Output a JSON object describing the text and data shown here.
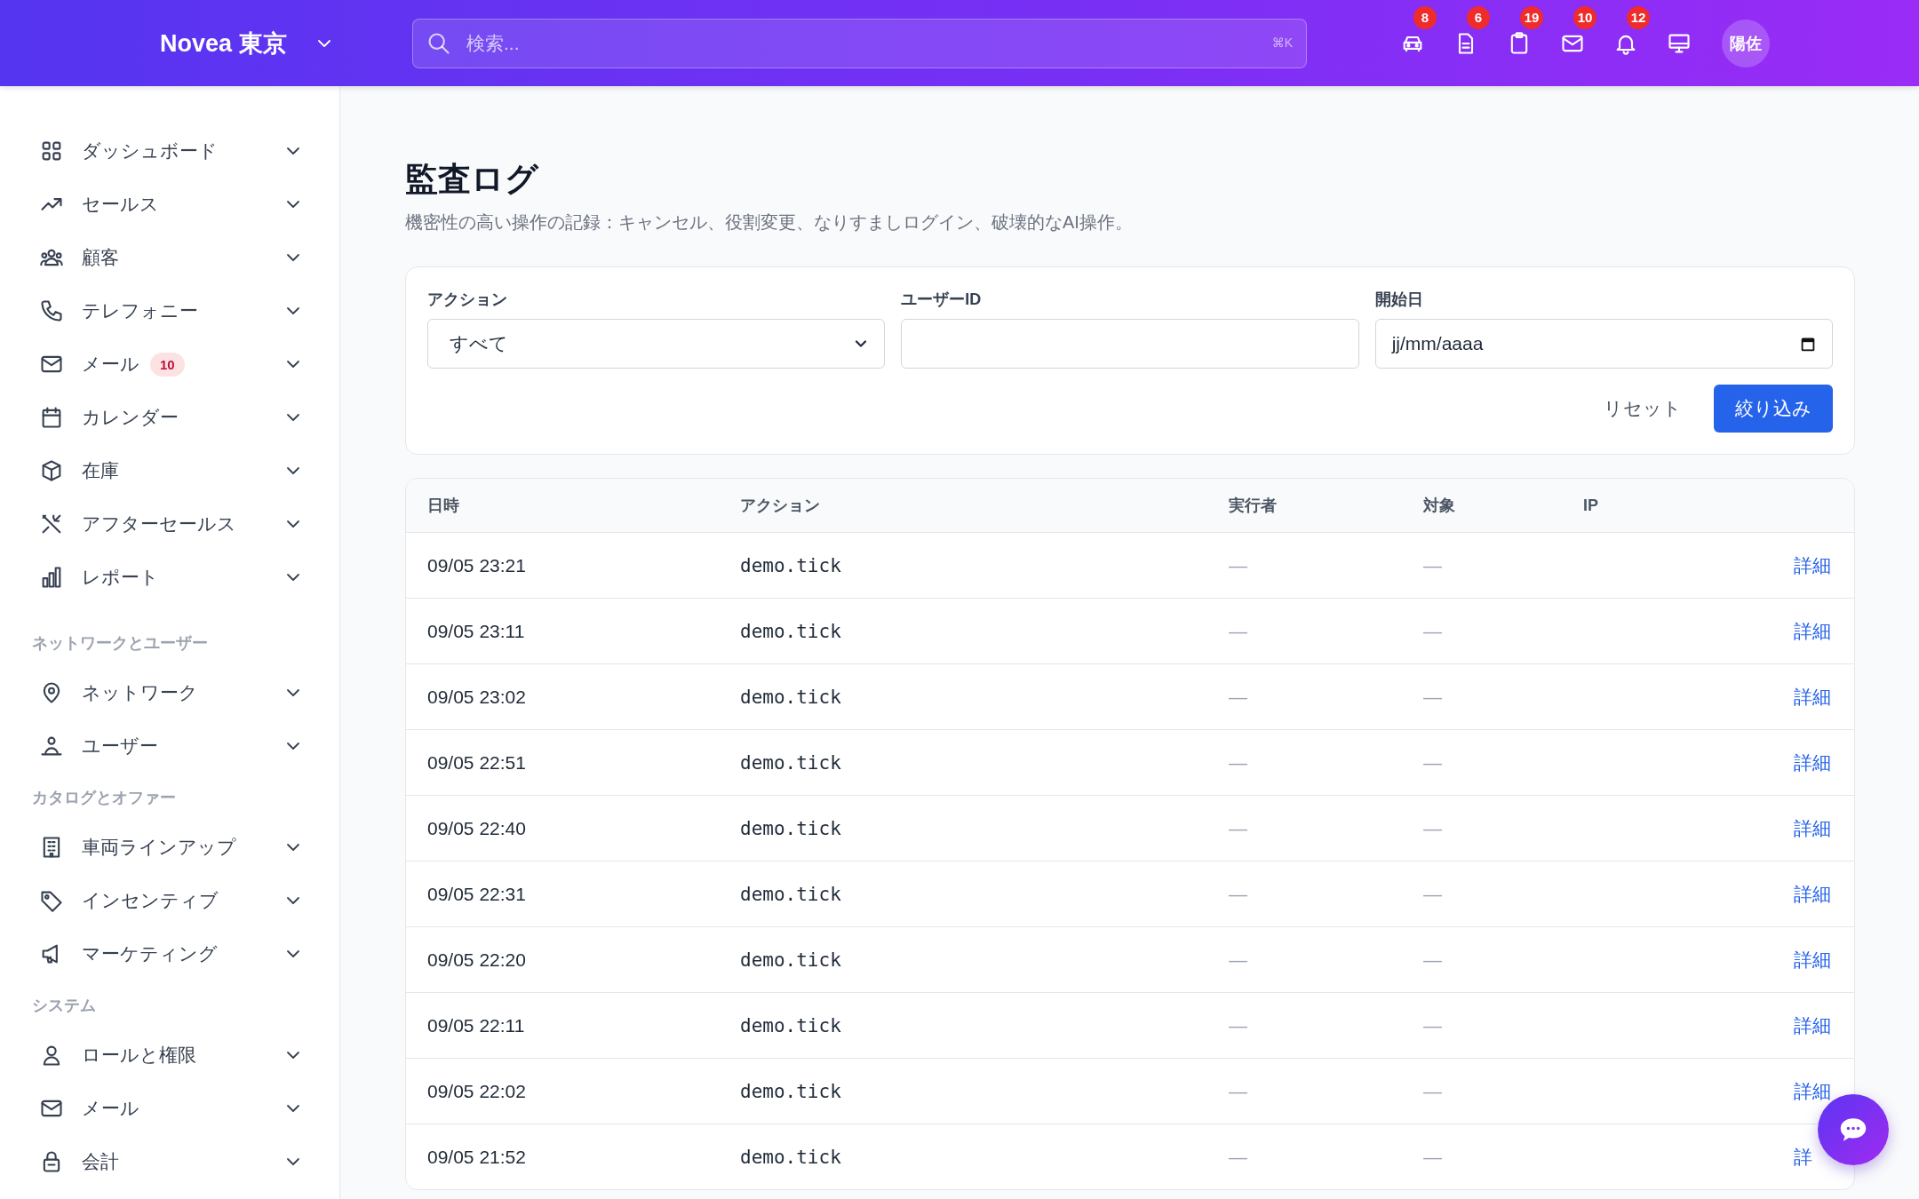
{
  "header": {
    "brand": "Novea 東京",
    "search": {
      "placeholder": "検索...",
      "shortcut": "⌘K"
    },
    "icons": [
      {
        "kind": "car",
        "badge": "8"
      },
      {
        "kind": "file",
        "badge": "6"
      },
      {
        "kind": "clipboard",
        "badge": "19"
      },
      {
        "kind": "mail",
        "badge": "10"
      },
      {
        "kind": "bell",
        "badge": "12"
      },
      {
        "kind": "monitor"
      }
    ],
    "avatar": "陽佐"
  },
  "sidebar": {
    "sections": [
      {
        "items": [
          {
            "label": "ダッシュボード"
          },
          {
            "label": "セールス"
          },
          {
            "label": "顧客"
          },
          {
            "label": "テレフォニー"
          },
          {
            "label": "メール",
            "badge": "10"
          },
          {
            "label": "カレンダー"
          },
          {
            "label": "在庫"
          },
          {
            "label": "アフターセールス"
          },
          {
            "label": "レポート"
          }
        ]
      },
      {
        "heading": "ネットワークとユーザー",
        "items": [
          {
            "label": "ネットワーク"
          },
          {
            "label": "ユーザー"
          }
        ]
      },
      {
        "heading": "カタログとオファー",
        "items": [
          {
            "label": "車両ラインアップ"
          },
          {
            "label": "インセンティブ"
          },
          {
            "label": "マーケティング"
          }
        ]
      },
      {
        "heading": "システム",
        "items": [
          {
            "label": "ロールと権限"
          },
          {
            "label": "メール"
          },
          {
            "label": "会計"
          }
        ]
      }
    ]
  },
  "page": {
    "title": "監査ログ",
    "subtitle": "機密性の高い操作の記録：キャンセル、役割変更、なりすましログイン、破壊的なAI操作。"
  },
  "filters": {
    "action": {
      "label": "アクション",
      "value": "すべて"
    },
    "user_id": {
      "label": "ユーザーID"
    },
    "start_date": {
      "label": "開始日",
      "value": "jj/mm/aaaa"
    },
    "reset": "リセット",
    "apply": "絞り込み"
  },
  "table": {
    "columns": [
      "日時",
      "アクション",
      "実行者",
      "対象",
      "IP"
    ],
    "rows": [
      {
        "time": "09/05 23:21",
        "action": "demo.tick",
        "actor": "—",
        "target": "—",
        "link": "詳細"
      },
      {
        "time": "09/05 23:11",
        "action": "demo.tick",
        "actor": "—",
        "target": "—",
        "link": "詳細"
      },
      {
        "time": "09/05 23:02",
        "action": "demo.tick",
        "actor": "—",
        "target": "—",
        "link": "詳細"
      },
      {
        "time": "09/05 22:51",
        "action": "demo.tick",
        "actor": "—",
        "target": "—",
        "link": "詳細"
      },
      {
        "time": "09/05 22:40",
        "action": "demo.tick",
        "actor": "—",
        "target": "—",
        "link": "詳細"
      },
      {
        "time": "09/05 22:31",
        "action": "demo.tick",
        "actor": "—",
        "target": "—",
        "link": "詳細"
      },
      {
        "time": "09/05 22:20",
        "action": "demo.tick",
        "actor": "—",
        "target": "—",
        "link": "詳細"
      },
      {
        "time": "09/05 22:11",
        "action": "demo.tick",
        "actor": "—",
        "target": "—",
        "link": "詳細"
      },
      {
        "time": "09/05 22:02",
        "action": "demo.tick",
        "actor": "—",
        "target": "—",
        "link": "詳細"
      },
      {
        "time": "09/05 21:52",
        "action": "demo.tick",
        "actor": "—",
        "target": "—",
        "link": "詳"
      }
    ]
  }
}
